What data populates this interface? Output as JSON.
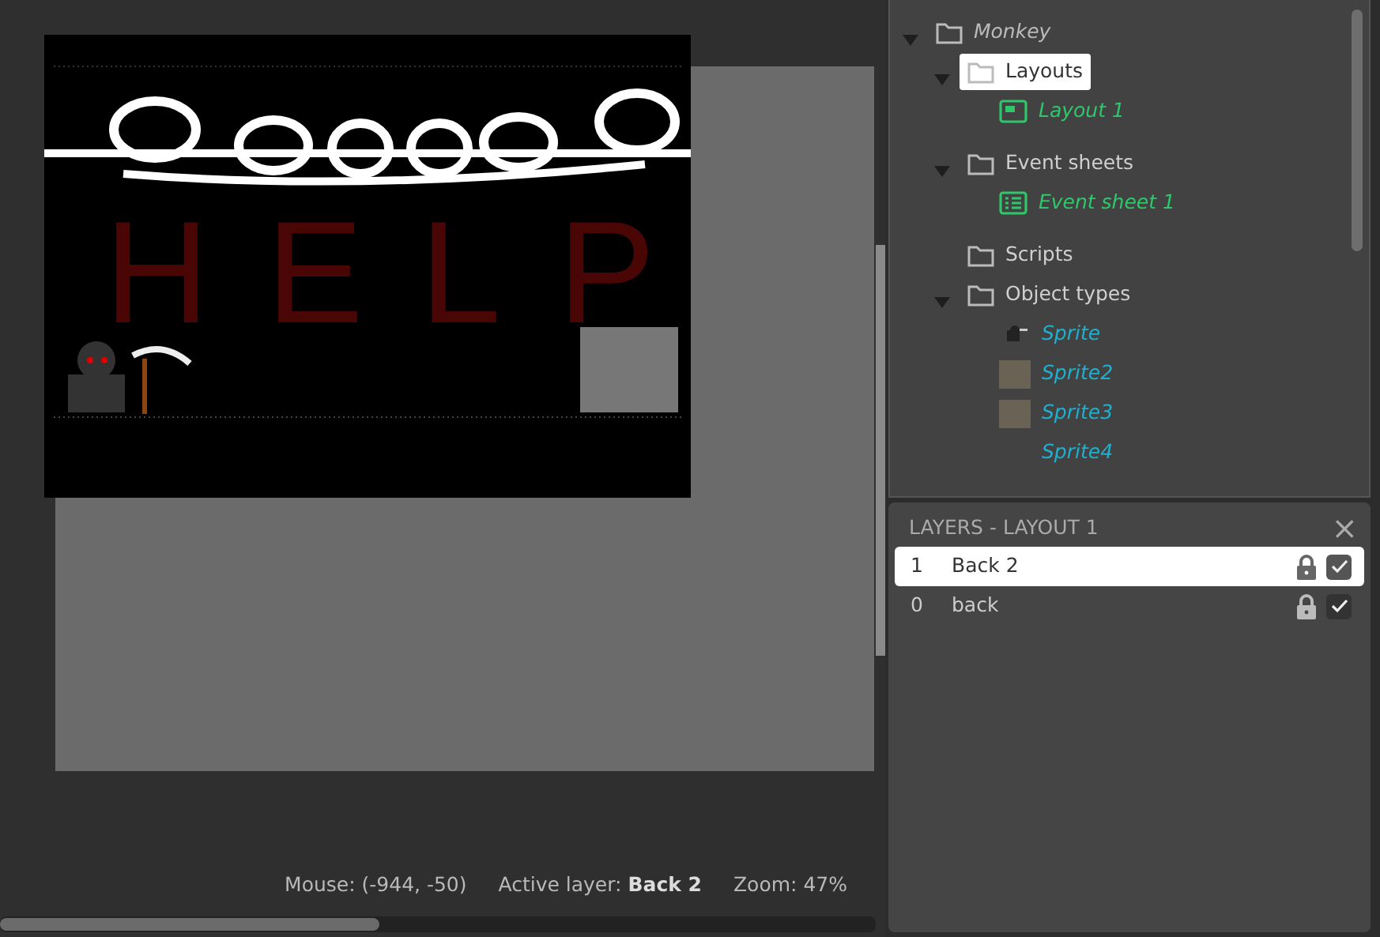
{
  "canvas": {
    "scene_text": "HELP"
  },
  "status_bar": {
    "mouse": "Mouse: (-944, -50)",
    "active_layer": "Active layer: **Back 2**",
    "zoom": "Zoom: 47%"
  },
  "project_tree": [
    {
      "label": "Monkey",
      "kind": "project",
      "expanded": true,
      "selected": false,
      "children": [
        {
          "label": "Layouts",
          "kind": "folder",
          "expanded": true,
          "selected": true,
          "children": [
            {
              "label": "Layout 1",
              "kind": "layout",
              "selected": false
            }
          ]
        },
        {
          "label": "Event sheets",
          "kind": "folder",
          "expanded": true,
          "selected": false,
          "children": [
            {
              "label": "Event sheet 1",
              "kind": "eventsheet",
              "selected": false
            }
          ]
        },
        {
          "label": "Scripts",
          "kind": "folder",
          "selected": false
        },
        {
          "label": "Object types",
          "kind": "folder",
          "expanded": true,
          "selected": false,
          "children": [
            {
              "label": "Sprite",
              "kind": "figure",
              "selected": false
            },
            {
              "label": "Sprite2",
              "kind": "photo",
              "selected": false
            },
            {
              "label": "Sprite3",
              "kind": "photo",
              "selected": false
            },
            {
              "label": "Sprite4",
              "kind": "blank",
              "selected": false
            }
          ]
        }
      ]
    }
  ],
  "layers_panel": {
    "title": "LAYERS - LAYOUT 1",
    "close": "×",
    "layers": [
      {
        "number": "1",
        "name": "Back 2",
        "selected": true,
        "visible": true
      },
      {
        "number": "0",
        "name": "back",
        "selected": false,
        "visible": true
      }
    ]
  }
}
